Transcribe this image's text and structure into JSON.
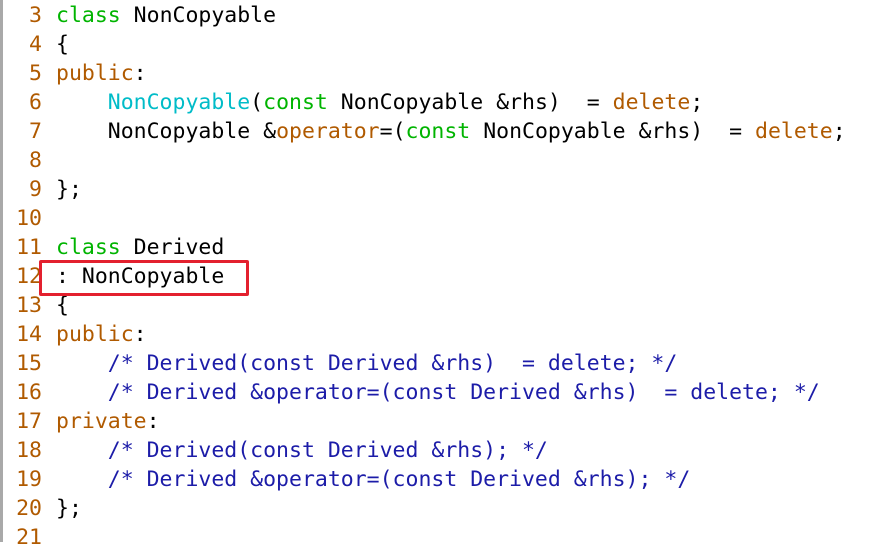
{
  "editor": {
    "lines": [
      {
        "num": "3",
        "tokens": [
          [
            "kw",
            "class"
          ],
          [
            "pl",
            " NonCopyable"
          ]
        ]
      },
      {
        "num": "4",
        "tokens": [
          [
            "pl",
            "{"
          ]
        ]
      },
      {
        "num": "5",
        "tokens": [
          [
            "mod",
            "public"
          ],
          [
            "pl",
            ":"
          ]
        ]
      },
      {
        "num": "6",
        "tokens": [
          [
            "pl",
            "    "
          ],
          [
            "ctor",
            "NonCopyable"
          ],
          [
            "pl",
            "("
          ],
          [
            "kw",
            "const"
          ],
          [
            "pl",
            " NonCopyable &rhs)  = "
          ],
          [
            "mod",
            "delete"
          ],
          [
            "pl",
            ";"
          ]
        ]
      },
      {
        "num": "7",
        "tokens": [
          [
            "pl",
            "    NonCopyable &"
          ],
          [
            "mod",
            "operator"
          ],
          [
            "pl",
            "=("
          ],
          [
            "kw",
            "const"
          ],
          [
            "pl",
            " NonCopyable &rhs)  = "
          ],
          [
            "mod",
            "delete"
          ],
          [
            "pl",
            ";"
          ]
        ]
      },
      {
        "num": "8",
        "tokens": []
      },
      {
        "num": "9",
        "tokens": [
          [
            "pl",
            "};"
          ]
        ]
      },
      {
        "num": "10",
        "tokens": []
      },
      {
        "num": "11",
        "tokens": [
          [
            "kw",
            "class"
          ],
          [
            "pl",
            " Derived"
          ]
        ]
      },
      {
        "num": "12",
        "tokens": [
          [
            "pl",
            ": NonCopyable"
          ]
        ]
      },
      {
        "num": "13",
        "tokens": [
          [
            "pl",
            "{"
          ]
        ]
      },
      {
        "num": "14",
        "tokens": [
          [
            "mod",
            "public"
          ],
          [
            "pl",
            ":"
          ]
        ]
      },
      {
        "num": "15",
        "tokens": [
          [
            "pl",
            "    "
          ],
          [
            "cm",
            "/* Derived(const Derived &rhs)  = delete; */"
          ]
        ]
      },
      {
        "num": "16",
        "tokens": [
          [
            "pl",
            "    "
          ],
          [
            "cm",
            "/* Derived &operator=(const Derived &rhs)  = delete; */"
          ]
        ]
      },
      {
        "num": "17",
        "tokens": [
          [
            "mod",
            "private"
          ],
          [
            "pl",
            ":"
          ]
        ]
      },
      {
        "num": "18",
        "tokens": [
          [
            "pl",
            "    "
          ],
          [
            "cm",
            "/* Derived(const Derived &rhs); */"
          ]
        ]
      },
      {
        "num": "19",
        "tokens": [
          [
            "pl",
            "    "
          ],
          [
            "cm",
            "/* Derived &operator=(const Derived &rhs); */"
          ]
        ]
      },
      {
        "num": "20",
        "tokens": [
          [
            "pl",
            "};"
          ]
        ]
      },
      {
        "num": "21",
        "tokens": []
      }
    ],
    "highlight_color": "#e3202e"
  }
}
